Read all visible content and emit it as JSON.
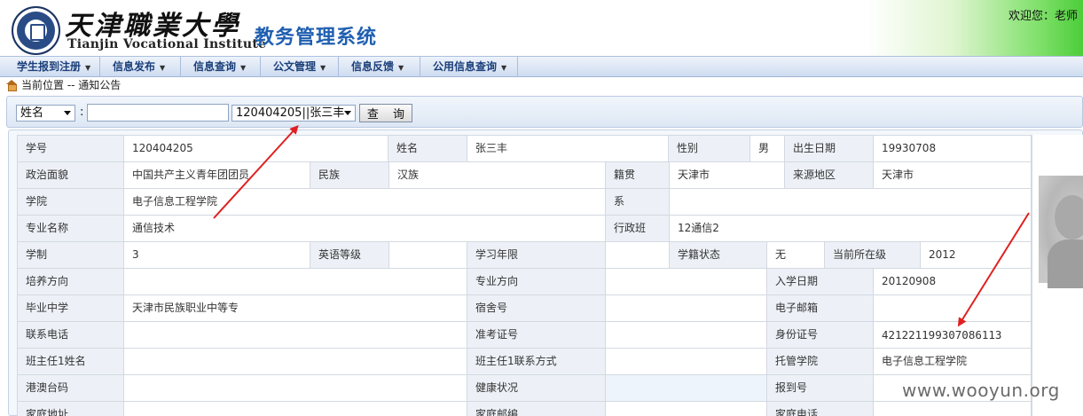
{
  "header": {
    "school_name_cn": "天津職業大學",
    "school_name_en": "Tianjin Vocational Institute",
    "system_title": "教务管理系统",
    "welcome": "欢迎您：老师"
  },
  "nav": {
    "items": [
      {
        "label": "学生报到注册"
      },
      {
        "label": "信息发布"
      },
      {
        "label": "信息查询"
      },
      {
        "label": "公文管理"
      },
      {
        "label": "信息反馈"
      },
      {
        "label": "公用信息查询"
      }
    ]
  },
  "breadcrumb": "当前位置 -- 通知公告",
  "search": {
    "field_select": "姓名",
    "colon": ":",
    "input_value": "",
    "result_select": "120404205||张三丰",
    "query_button": "查 询"
  },
  "student": {
    "labels": {
      "student_id": "学号",
      "name": "姓名",
      "gender": "性别",
      "birth_date": "出生日期",
      "political_status": "政治面貌",
      "ethnicity": "民族",
      "native_place": "籍贯",
      "origin_region": "来源地区",
      "college": "学院",
      "department": "系",
      "major": "专业名称",
      "admin_class": "行政班",
      "school_years": "学制",
      "english_level": "英语等级",
      "study_years": "学习年限",
      "enrollment_status": "学籍状态",
      "current_grade": "当前所在级",
      "training_direction": "培养方向",
      "major_direction": "专业方向",
      "enrollment_date": "入学日期",
      "graduated_school": "毕业中学",
      "dorm_no": "宿舍号",
      "email": "电子邮箱",
      "phone": "联系电话",
      "exam_no": "准考证号",
      "id_no": "身份证号",
      "head_teacher_name": "班主任1姓名",
      "head_teacher_contact": "班主任1联系方式",
      "managing_college": "托管学院",
      "hk_macau_tw": "港澳台码",
      "health": "健康状况",
      "registration_no": "报到号",
      "home_address": "家庭地址",
      "home_postcode": "家庭邮编",
      "home_phone": "家庭电话"
    },
    "values": {
      "student_id": "120404205",
      "name": "张三丰",
      "gender": "男",
      "birth_date": "19930708",
      "political_status": "中国共产主义青年团团员",
      "ethnicity": "汉族",
      "native_place": "天津市",
      "origin_region": "天津市",
      "college": "电子信息工程学院",
      "department": "",
      "major": "通信技术",
      "admin_class": "12通信2",
      "school_years": "3",
      "english_level": "",
      "study_years": "",
      "enrollment_status": "无",
      "current_grade": "2012",
      "training_direction": "",
      "major_direction": "",
      "enrollment_date": "20120908",
      "graduated_school": "天津市民族职业中等专",
      "dorm_no": "",
      "email": "",
      "phone": "",
      "exam_no": "",
      "id_no": "421221199307086113",
      "head_teacher_name": "",
      "head_teacher_contact": "",
      "managing_college": "电子信息工程学院",
      "hk_macau_tw": "",
      "health": "",
      "registration_no": "",
      "home_address": "",
      "home_postcode": "",
      "home_phone": ""
    }
  },
  "watermark": "www.wooyun.org",
  "colors": {
    "accent": "#1f5fb0",
    "nav_text": "#1b3f7a",
    "arrow": "#e02020"
  }
}
